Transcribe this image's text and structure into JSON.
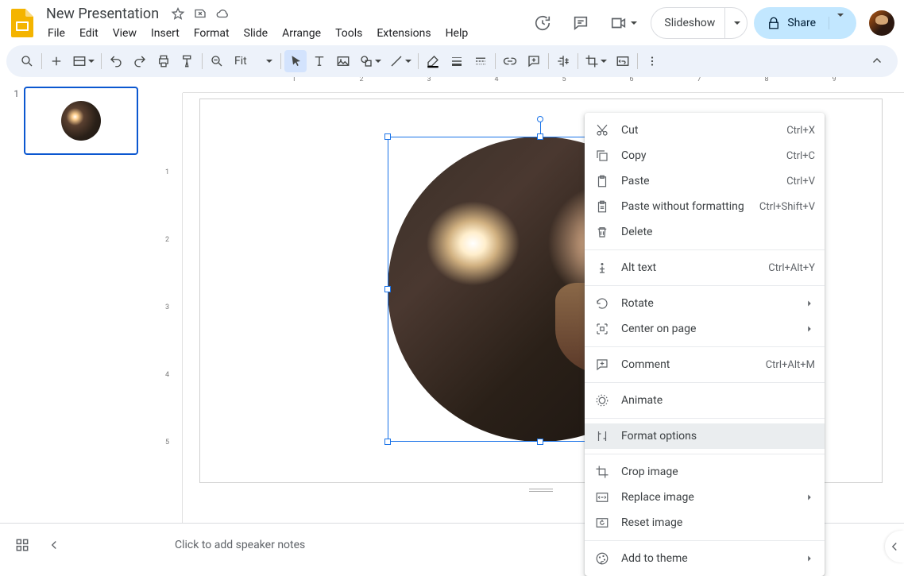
{
  "header": {
    "title": "New Presentation",
    "menu": [
      "File",
      "Edit",
      "View",
      "Insert",
      "Format",
      "Slide",
      "Arrange",
      "Tools",
      "Extensions",
      "Help"
    ],
    "slideshow": "Slideshow",
    "share": "Share"
  },
  "toolbar": {
    "zoom": "Fit"
  },
  "slidepanel": {
    "slides": [
      {
        "num": "1"
      }
    ]
  },
  "ruler": {
    "h": [
      "1",
      "2",
      "3",
      "4",
      "5",
      "6",
      "7",
      "8",
      "9"
    ],
    "v": [
      "1",
      "2",
      "3",
      "4",
      "5"
    ]
  },
  "context_menu": {
    "items": [
      {
        "icon": "cut",
        "label": "Cut",
        "shortcut": "Ctrl+X"
      },
      {
        "icon": "copy",
        "label": "Copy",
        "shortcut": "Ctrl+C"
      },
      {
        "icon": "paste",
        "label": "Paste",
        "shortcut": "Ctrl+V"
      },
      {
        "icon": "paste-no-fmt",
        "label": "Paste without formatting",
        "shortcut": "Ctrl+Shift+V"
      },
      {
        "icon": "delete",
        "label": "Delete"
      },
      {
        "sep": true
      },
      {
        "icon": "alt-text",
        "label": "Alt text",
        "shortcut": "Ctrl+Alt+Y"
      },
      {
        "sep": true
      },
      {
        "icon": "rotate",
        "label": "Rotate",
        "submenu": true
      },
      {
        "icon": "center",
        "label": "Center on page",
        "submenu": true
      },
      {
        "sep": true
      },
      {
        "icon": "comment",
        "label": "Comment",
        "shortcut": "Ctrl+Alt+M"
      },
      {
        "sep": true
      },
      {
        "icon": "animate",
        "label": "Animate"
      },
      {
        "sep": true
      },
      {
        "icon": "format-opts",
        "label": "Format options",
        "hover": true
      },
      {
        "sep": true
      },
      {
        "icon": "crop",
        "label": "Crop image"
      },
      {
        "icon": "replace",
        "label": "Replace image",
        "submenu": true
      },
      {
        "icon": "reset",
        "label": "Reset image"
      },
      {
        "sep": true
      },
      {
        "icon": "theme",
        "label": "Add to theme",
        "submenu": true
      }
    ]
  },
  "notes": {
    "placeholder": "Click to add speaker notes"
  }
}
